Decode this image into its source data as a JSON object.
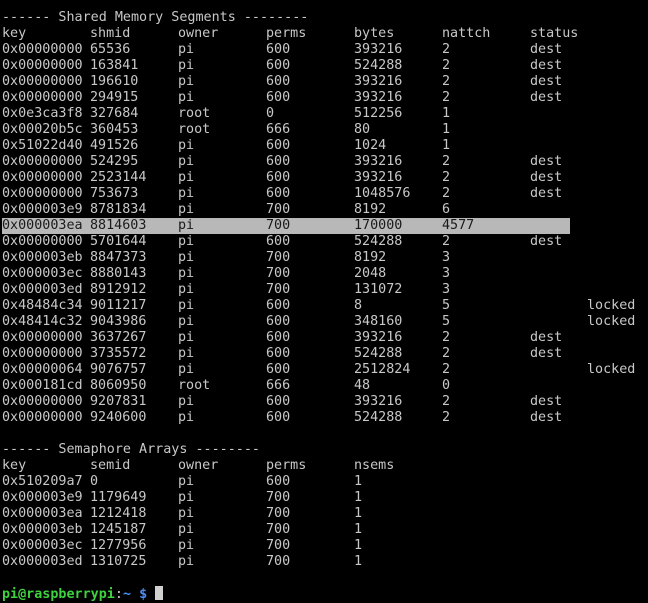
{
  "shm": {
    "title": "------ Shared Memory Segments --------",
    "headers": [
      "key",
      "shmid",
      "owner",
      "perms",
      "bytes",
      "nattch",
      "status"
    ],
    "rows": [
      [
        "0x00000000",
        "65536",
        "pi",
        "600",
        "393216",
        "2",
        "dest",
        ""
      ],
      [
        "0x00000000",
        "163841",
        "pi",
        "600",
        "524288",
        "2",
        "dest",
        ""
      ],
      [
        "0x00000000",
        "196610",
        "pi",
        "600",
        "393216",
        "2",
        "dest",
        ""
      ],
      [
        "0x00000000",
        "294915",
        "pi",
        "600",
        "393216",
        "2",
        "dest",
        ""
      ],
      [
        "0x0e3ca3f8",
        "327684",
        "root",
        "0",
        "512256",
        "1",
        "",
        ""
      ],
      [
        "0x00020b5c",
        "360453",
        "root",
        "666",
        "80",
        "1",
        "",
        ""
      ],
      [
        "0x51022d40",
        "491526",
        "pi",
        "600",
        "1024",
        "1",
        "",
        ""
      ],
      [
        "0x00000000",
        "524295",
        "pi",
        "600",
        "393216",
        "2",
        "dest",
        ""
      ],
      [
        "0x00000000",
        "2523144",
        "pi",
        "600",
        "393216",
        "2",
        "dest",
        ""
      ],
      [
        "0x00000000",
        "753673",
        "pi",
        "600",
        "1048576",
        "2",
        "dest",
        ""
      ],
      [
        "0x000003e9",
        "8781834",
        "pi",
        "700",
        "8192",
        "6",
        "",
        ""
      ],
      [
        "0x000003ea",
        "8814603",
        "pi",
        "700",
        "170000",
        "4577",
        "",
        ""
      ],
      [
        "0x00000000",
        "5701644",
        "pi",
        "600",
        "524288",
        "2",
        "dest",
        ""
      ],
      [
        "0x000003eb",
        "8847373",
        "pi",
        "700",
        "8192",
        "3",
        "",
        ""
      ],
      [
        "0x000003ec",
        "8880143",
        "pi",
        "700",
        "2048",
        "3",
        "",
        ""
      ],
      [
        "0x000003ed",
        "8912912",
        "pi",
        "700",
        "131072",
        "3",
        "",
        ""
      ],
      [
        "0x48484c34",
        "9011217",
        "pi",
        "600",
        "8",
        "5",
        "",
        "locked"
      ],
      [
        "0x48414c32",
        "9043986",
        "pi",
        "600",
        "348160",
        "5",
        "",
        "locked"
      ],
      [
        "0x00000000",
        "3637267",
        "pi",
        "600",
        "393216",
        "2",
        "dest",
        ""
      ],
      [
        "0x00000000",
        "3735572",
        "pi",
        "600",
        "524288",
        "2",
        "dest",
        ""
      ],
      [
        "0x00000064",
        "9076757",
        "pi",
        "600",
        "2512824",
        "2",
        "",
        "locked"
      ],
      [
        "0x000181cd",
        "8060950",
        "root",
        "666",
        "48",
        "0",
        "",
        ""
      ],
      [
        "0x00000000",
        "9207831",
        "pi",
        "600",
        "393216",
        "2",
        "dest",
        ""
      ],
      [
        "0x00000000",
        "9240600",
        "pi",
        "600",
        "524288",
        "2",
        "dest",
        ""
      ]
    ]
  },
  "sem": {
    "title": "------ Semaphore Arrays --------",
    "headers": [
      "key",
      "semid",
      "owner",
      "perms",
      "nsems"
    ],
    "rows": [
      [
        "0x510209a7",
        "0",
        "pi",
        "600",
        "1"
      ],
      [
        "0x000003e9",
        "1179649",
        "pi",
        "700",
        "1"
      ],
      [
        "0x000003ea",
        "1212418",
        "pi",
        "700",
        "1"
      ],
      [
        "0x000003eb",
        "1245187",
        "pi",
        "700",
        "1"
      ],
      [
        "0x000003ec",
        "1277956",
        "pi",
        "700",
        "1"
      ],
      [
        "0x000003ed",
        "1310725",
        "pi",
        "700",
        "1"
      ]
    ]
  },
  "prompt": {
    "user_host": "pi@raspberrypi",
    "colon": ":",
    "path": "~",
    "symbol": "$"
  },
  "highlight_row_index": 11,
  "colors": {
    "background": "#000000",
    "text": "#c8c8c8",
    "highlight": "#b8b8b8",
    "prompt_user": "#3fd13f",
    "prompt_path": "#4d8df5"
  }
}
